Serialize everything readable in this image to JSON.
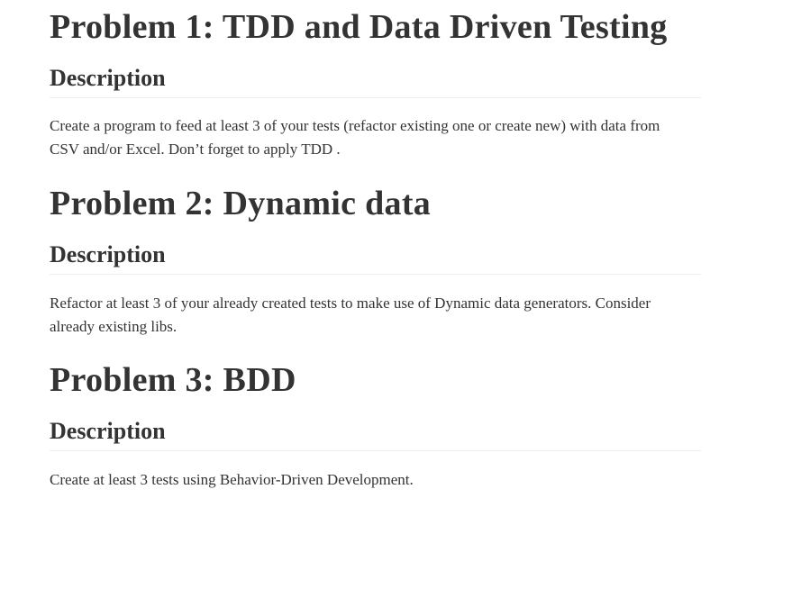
{
  "problems": [
    {
      "title": "Problem 1: TDD and Data Driven Testing",
      "subheading": "Description",
      "description": "Create a program to feed at least 3 of your tests (refactor existing one or create new) with data from CSV and/or Excel. Don’t forget to apply TDD ."
    },
    {
      "title": "Problem 2: Dynamic data",
      "subheading": "Description",
      "description": "Refactor at least 3 of your already created tests to make use of Dynamic data generators. Consider already existing libs."
    },
    {
      "title": "Problem 3: BDD",
      "subheading": "Description",
      "description": "Create at least 3 tests using Behavior-Driven Development."
    }
  ]
}
